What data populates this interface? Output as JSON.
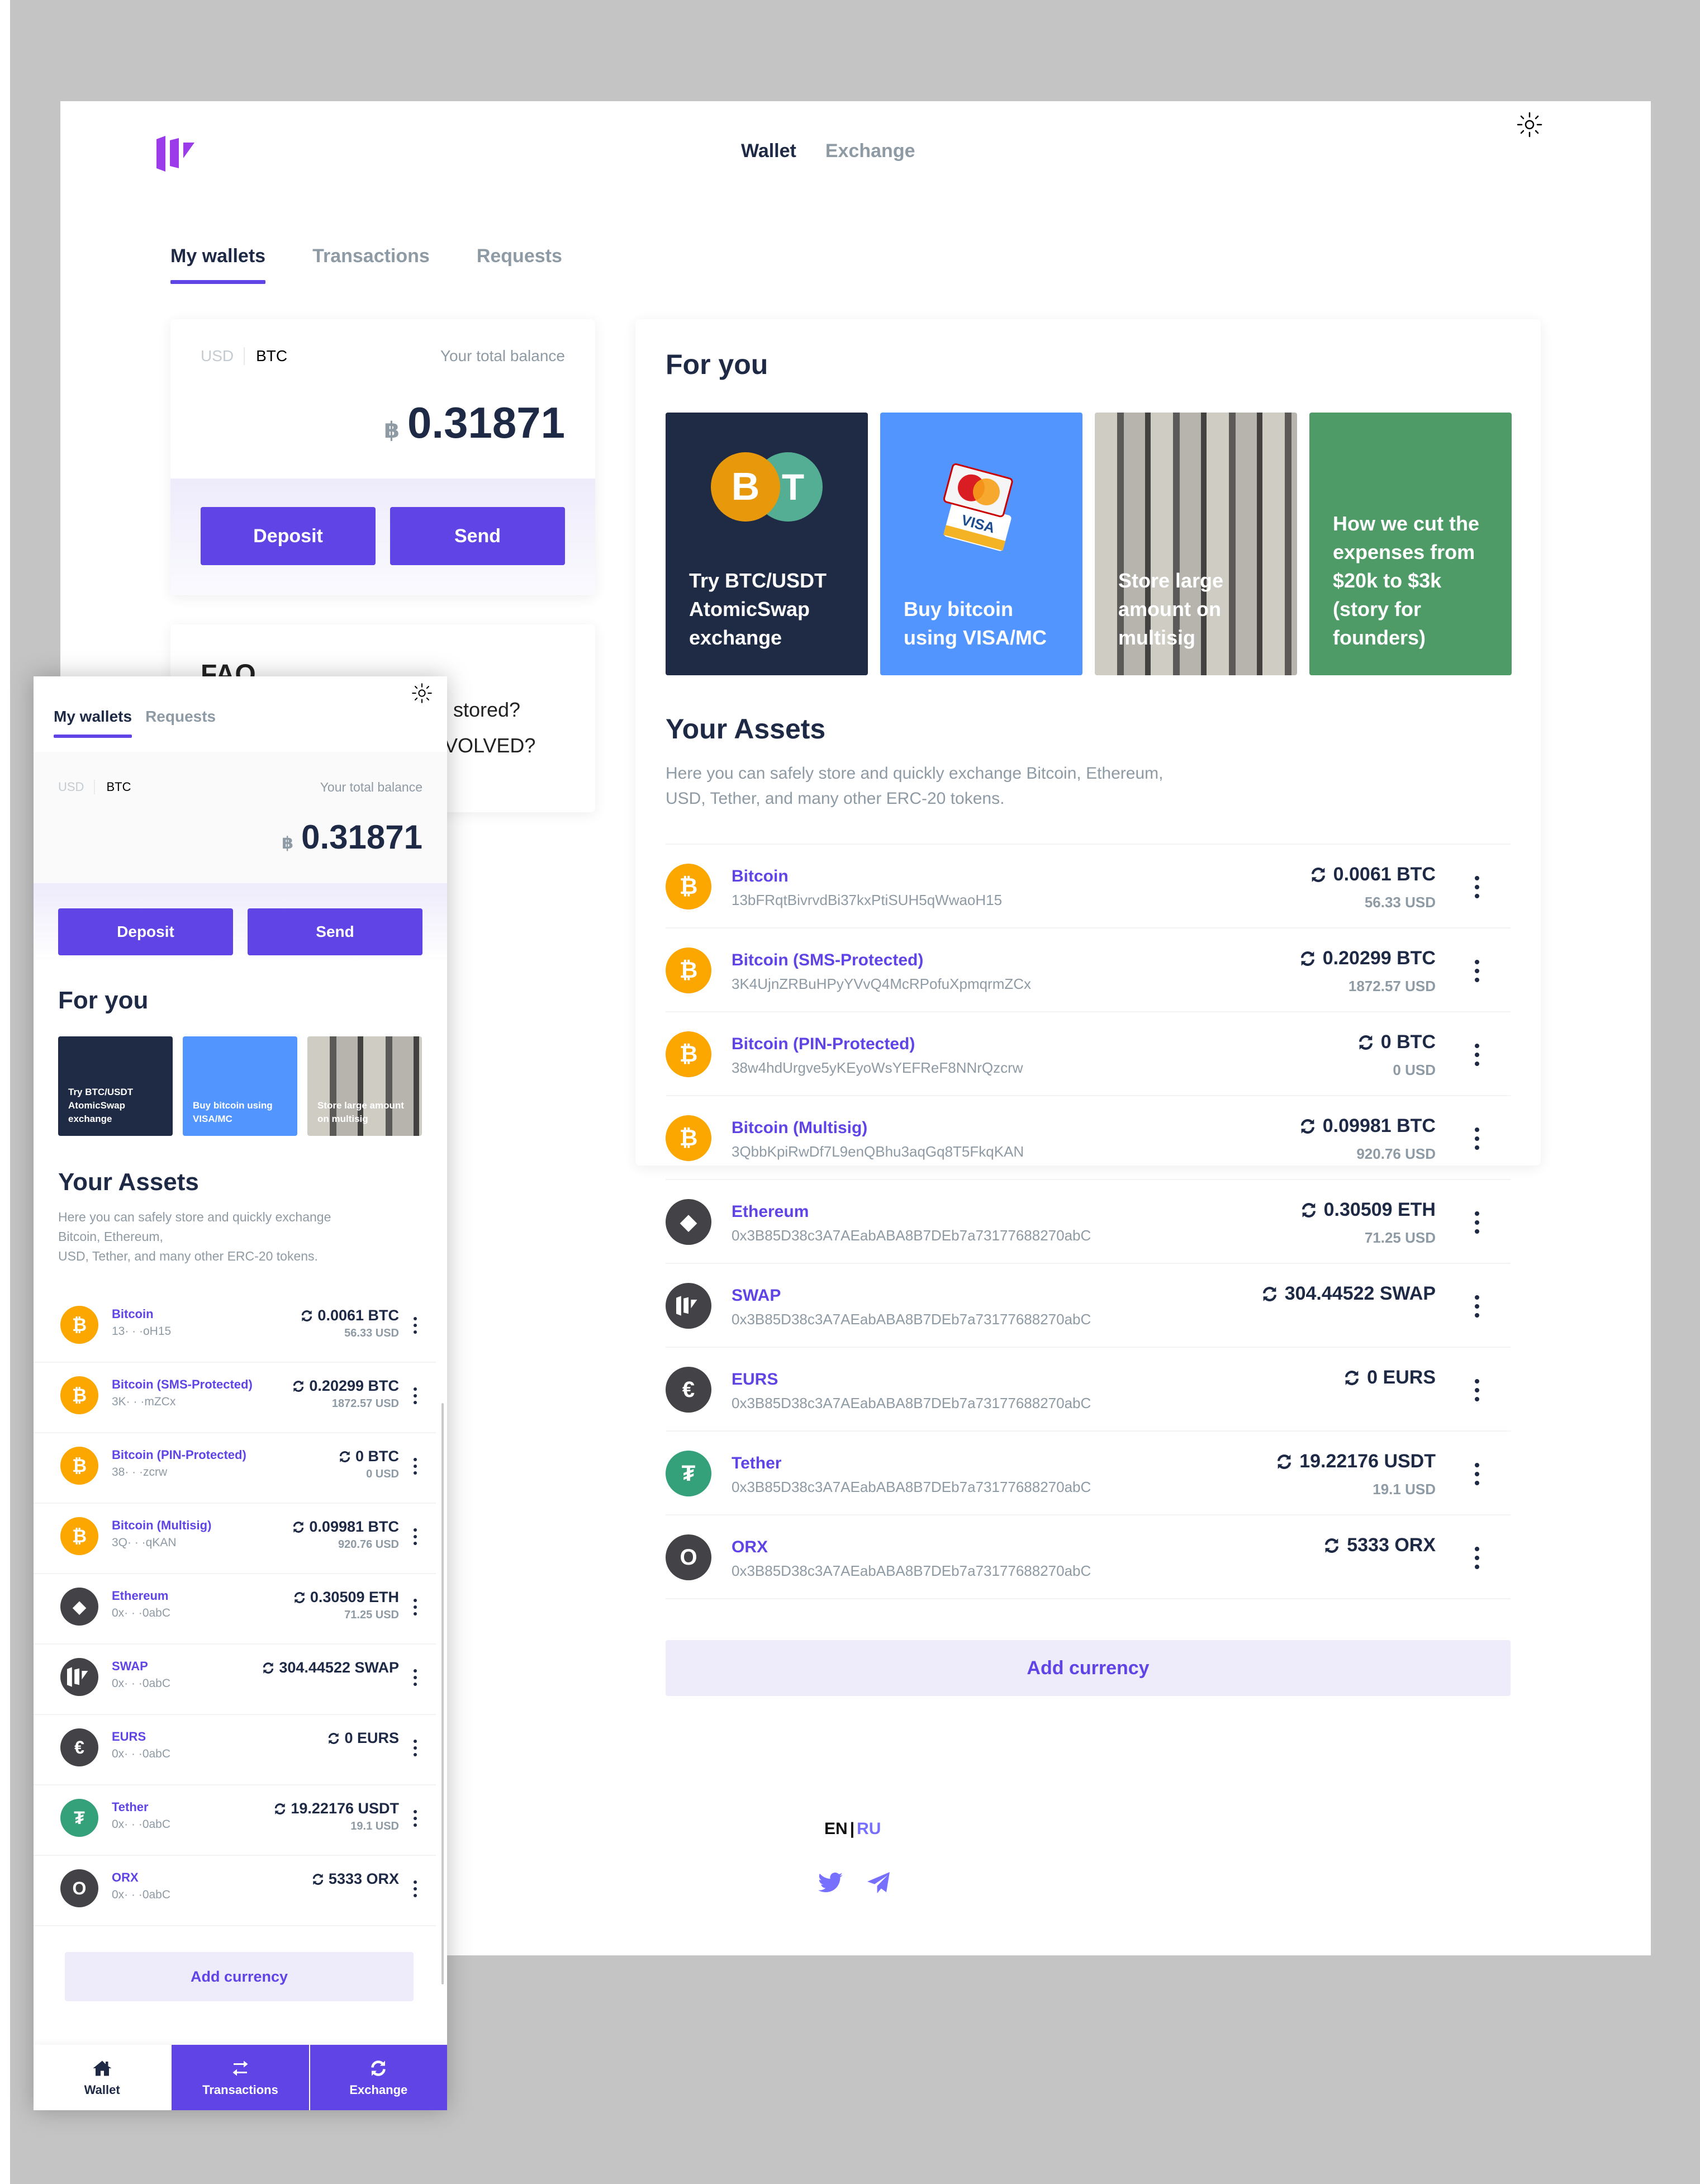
{
  "colors": {
    "accent": "#6144e5",
    "logo": "#9b3bea",
    "btc": "#fca600",
    "tether": "#34a17b",
    "dark_coin": "#434246",
    "promo_dark": "#1f2b45",
    "promo_blue": "#5295fe",
    "promo_green": "#4f9b68"
  },
  "header": {
    "nav": [
      {
        "label": "Wallet",
        "active": true
      },
      {
        "label": "Exchange",
        "active": false
      }
    ],
    "theme_toggle_icon": "sun-icon"
  },
  "tabs": [
    {
      "label": "My wallets",
      "active": true
    },
    {
      "label": "Transactions",
      "active": false
    },
    {
      "label": "Requests",
      "active": false
    }
  ],
  "balance": {
    "currency_options": [
      "USD",
      "BTC"
    ],
    "selected_currency": "BTC",
    "label": "Your total balance",
    "symbol": "฿",
    "amount": "0.31871",
    "deposit_label": "Deposit",
    "send_label": "Send"
  },
  "faq": {
    "title": "FAQ",
    "questions_visible": [
      "s stored?",
      "VOLVED?"
    ]
  },
  "for_you": {
    "title": "For you",
    "cards": [
      {
        "text": "Try BTC/USDT AtomicSwap exchange",
        "style": "dark"
      },
      {
        "text": "Buy bitcoin using VISA/MC",
        "style": "blue"
      },
      {
        "text": "Store large amount on multisig",
        "style": "photo"
      },
      {
        "text": "How we cut the expenses from $20k to $3k (story for founders)",
        "style": "green"
      }
    ]
  },
  "assets": {
    "title": "Your Assets",
    "description_line1": "Here you can safely store and quickly exchange Bitcoin, Ethereum,",
    "description_line2": "USD, Tether, and many other ERC-20 tokens.",
    "mobile_description_line1": "Here you can safely store and quickly exchange",
    "mobile_description_line2": "Bitcoin, Ethereum,",
    "mobile_description_line3": "USD, Tether, and many other ERC-20 tokens.",
    "items": [
      {
        "name": "Bitcoin",
        "address": "13bFRqtBivrvdBi37kxPtiSUH5qWwaoH15",
        "short_address": "13· · ·oH15",
        "amount": "0.0061 BTC",
        "usd": "56.33 USD",
        "icon": "bitcoin-icon",
        "glyph": "₿",
        "color": "#fca600"
      },
      {
        "name": "Bitcoin (SMS-Protected)",
        "address": "3K4UjnZRBuHPyYVvQ4McRPofuXpmqrmZCx",
        "short_address": "3K· · ·mZCx",
        "amount": "0.20299 BTC",
        "usd": "1872.57 USD",
        "icon": "bitcoin-icon",
        "glyph": "₿",
        "color": "#fca600"
      },
      {
        "name": "Bitcoin (PIN-Protected)",
        "address": "38w4hdUrgve5yKEyoWsYEFReF8NNrQzcrw",
        "short_address": "38· · ·zcrw",
        "amount": "0 BTC",
        "usd": "0 USD",
        "icon": "bitcoin-icon",
        "glyph": "₿",
        "color": "#fca600"
      },
      {
        "name": "Bitcoin (Multisig)",
        "address": "3QbbKpiRwDf7L9enQBhu3aqGq8T5FkqKAN",
        "short_address": "3Q· · ·qKAN",
        "amount": "0.09981 BTC",
        "usd": "920.76 USD",
        "icon": "bitcoin-icon",
        "glyph": "₿",
        "color": "#fca600"
      },
      {
        "name": "Ethereum",
        "address": "0x3B85D38c3A7AEabABA8B7DEb7a73177688270abC",
        "short_address": "0x· · ·0abC",
        "amount": "0.30509 ETH",
        "usd": "71.25 USD",
        "icon": "ethereum-icon",
        "glyph": "◆",
        "color": "#434246"
      },
      {
        "name": "SWAP",
        "address": "0x3B85D38c3A7AEabABA8B7DEb7a73177688270abC",
        "short_address": "0x· · ·0abC",
        "amount": "304.44522 SWAP",
        "usd": "",
        "icon": "swap-logo-icon",
        "glyph": "",
        "color": "#434246"
      },
      {
        "name": "EURS",
        "address": "0x3B85D38c3A7AEabABA8B7DEb7a73177688270abC",
        "short_address": "0x· · ·0abC",
        "amount": "0 EURS",
        "usd": "",
        "icon": "euro-icon",
        "glyph": "€",
        "color": "#434246"
      },
      {
        "name": "Tether",
        "address": "0x3B85D38c3A7AEabABA8B7DEb7a73177688270abC",
        "short_address": "0x· · ·0abC",
        "amount": "19.22176 USDT",
        "usd": "19.1 USD",
        "icon": "tether-icon",
        "glyph": "₮",
        "color": "#34a17b"
      },
      {
        "name": "ORX",
        "address": "0x3B85D38c3A7AEabABA8B7DEb7a73177688270abC",
        "short_address": "0x· · ·0abC",
        "amount": "5333 ORX",
        "usd": "",
        "icon": "orx-icon",
        "glyph": "O",
        "color": "#434246"
      }
    ],
    "add_currency_label": "Add currency"
  },
  "footer": {
    "languages": [
      "EN",
      "RU"
    ],
    "active_language": "EN",
    "separator": "|",
    "social": [
      "twitter-icon",
      "telegram-icon"
    ]
  },
  "mobile": {
    "tabs": [
      {
        "label": "My wallets",
        "active": true
      },
      {
        "label": "Requests",
        "active": false
      }
    ],
    "bottom_nav": [
      {
        "label": "Wallet",
        "icon": "home-icon",
        "active": true
      },
      {
        "label": "Transactions",
        "icon": "transfer-arrows-icon",
        "active": false
      },
      {
        "label": "Exchange",
        "icon": "refresh-icon",
        "active": false
      }
    ]
  }
}
